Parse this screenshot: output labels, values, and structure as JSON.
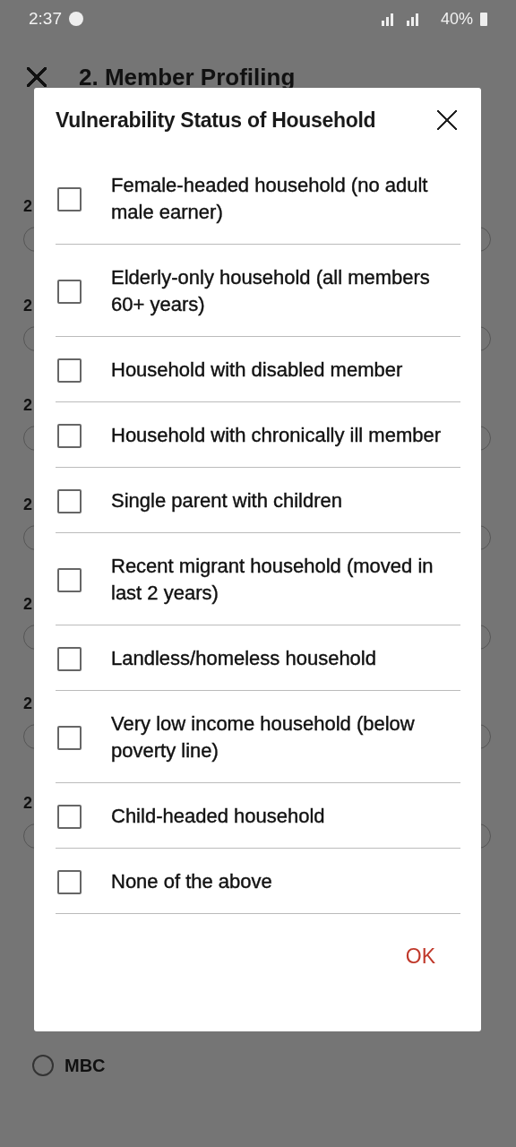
{
  "status_bar": {
    "time": "2:37",
    "battery": "40%"
  },
  "header": {
    "title": "2. Member Profiling"
  },
  "background_questions": [
    {
      "label": "2"
    },
    {
      "label": "2"
    },
    {
      "label": "2"
    },
    {
      "label": "2"
    },
    {
      "label": "2"
    },
    {
      "label": "2"
    },
    {
      "label": "2"
    }
  ],
  "background_options": [
    {
      "label": "MBC",
      "selected": false
    }
  ],
  "dialog": {
    "title": "Vulnerability Status of Household",
    "options": [
      {
        "label": "Female-headed household (no adult male earner)",
        "checked": false
      },
      {
        "label": "Elderly-only household (all members 60+ years)",
        "checked": false
      },
      {
        "label": "Household with disabled member",
        "checked": false
      },
      {
        "label": "Household with chronically ill member",
        "checked": false
      },
      {
        "label": "Single parent with children",
        "checked": false
      },
      {
        "label": "Recent migrant household (moved in last 2 years)",
        "checked": false
      },
      {
        "label": "Landless/homeless household",
        "checked": false
      },
      {
        "label": "Very low income household (below poverty line)",
        "checked": false
      },
      {
        "label": "Child-headed household",
        "checked": false
      },
      {
        "label": "None of the above",
        "checked": false
      }
    ],
    "ok_button": "OK"
  }
}
